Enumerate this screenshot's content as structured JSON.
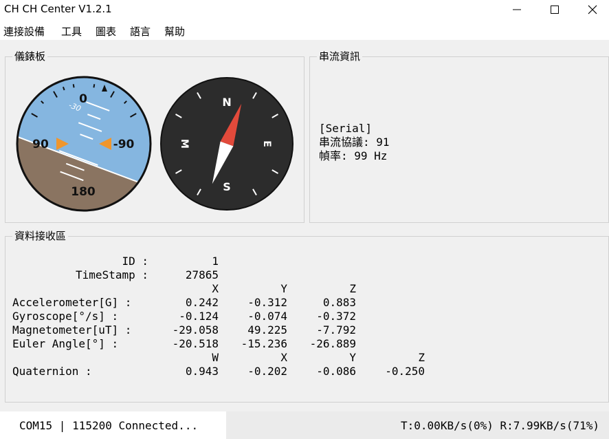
{
  "window": {
    "title": "CH CH Center V1.2.1"
  },
  "menu": [
    "連接設備",
    "工具",
    "圖表",
    "語言",
    "幫助"
  ],
  "gauges": {
    "title": "儀錶板",
    "attitude": {
      "roll_deg": -20.518,
      "pitch_deg": -15.236,
      "labels": {
        "top": "0",
        "left": "90",
        "right": "-90",
        "bottom": "180",
        "pitch_mark": "-30"
      },
      "colors": {
        "sky": "#85b6e0",
        "ground": "#8a7461",
        "marker": "#f0962d"
      }
    },
    "compass": {
      "heading_deg": 20,
      "labels": {
        "n": "N",
        "e": "E",
        "s": "S",
        "w": "M"
      },
      "colors": {
        "face": "#2c2c2c",
        "north": "#e24a3b",
        "south": "#ffffff"
      }
    }
  },
  "serial": {
    "title": "串流資訊",
    "lines": [
      "[Serial]",
      "串流協議: 91",
      "幀率: 99 Hz"
    ]
  },
  "data_area": {
    "title": "資料接收區",
    "id_label": "ID :",
    "id_value": "1",
    "ts_label": "TimeStamp :",
    "ts_value": "27865",
    "xyz_headers": [
      "X",
      "Y",
      "Z"
    ],
    "rows": [
      {
        "label": "Accelerometer[G] :",
        "values": [
          "0.242",
          "-0.312",
          "0.883"
        ]
      },
      {
        "label": "Gyroscope[°/s] :",
        "values": [
          "-0.124",
          "-0.074",
          "-0.372"
        ]
      },
      {
        "label": "Magnetometer[uT] :",
        "values": [
          "-29.058",
          "49.225",
          "-7.792"
        ]
      },
      {
        "label": "Euler Angle[°] :",
        "values": [
          "-20.518",
          "-15.236",
          "-26.889"
        ]
      }
    ],
    "wxyz_headers": [
      "W",
      "X",
      "Y",
      "Z"
    ],
    "quat_label": "Quaternion :",
    "quat_values": [
      "0.943",
      "-0.202",
      "-0.086",
      "-0.250"
    ]
  },
  "status": {
    "connection": "COM15 | 115200 Connected...",
    "throughput": "T:0.00KB/s(0%) R:7.99KB/s(71%)"
  }
}
